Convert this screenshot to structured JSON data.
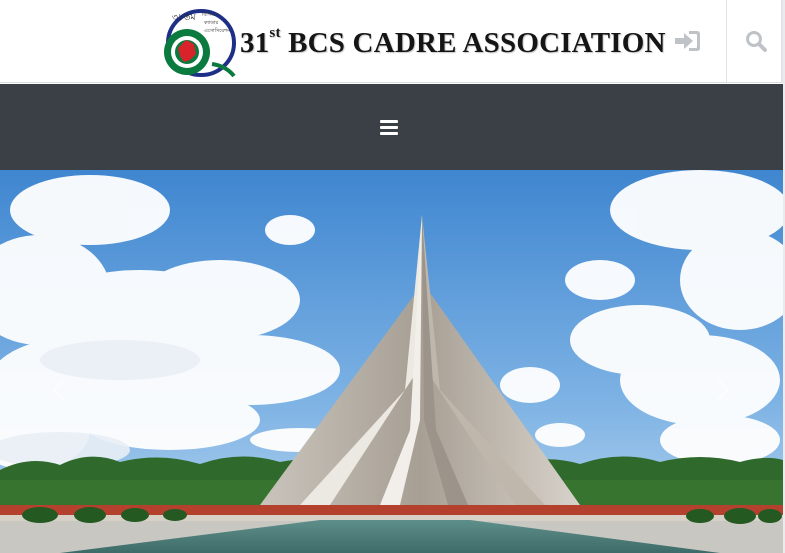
{
  "header": {
    "logo": {
      "emblem_lettering": "৩১তম বিসিএস ক্যাডার এসোসিয়েশন",
      "prefix": "31",
      "superscript": "st",
      "name": "BCS CADRE ASSOCIATION"
    },
    "login_icon": "sign-in-icon",
    "search_icon": "search-icon"
  },
  "navbar": {
    "menu_icon": "hamburger-menu-icon"
  },
  "hero": {
    "image_subject": "national-memorial-monument",
    "prev_icon": "chevron-left-icon",
    "next_icon": "chevron-right-icon"
  },
  "colors": {
    "navbar_bg": "#3b4046",
    "icon_gray": "#bfc3c7",
    "flag_green": "#0a7a3e",
    "flag_red": "#d8232a",
    "emblem_blue": "#1d2f86"
  }
}
